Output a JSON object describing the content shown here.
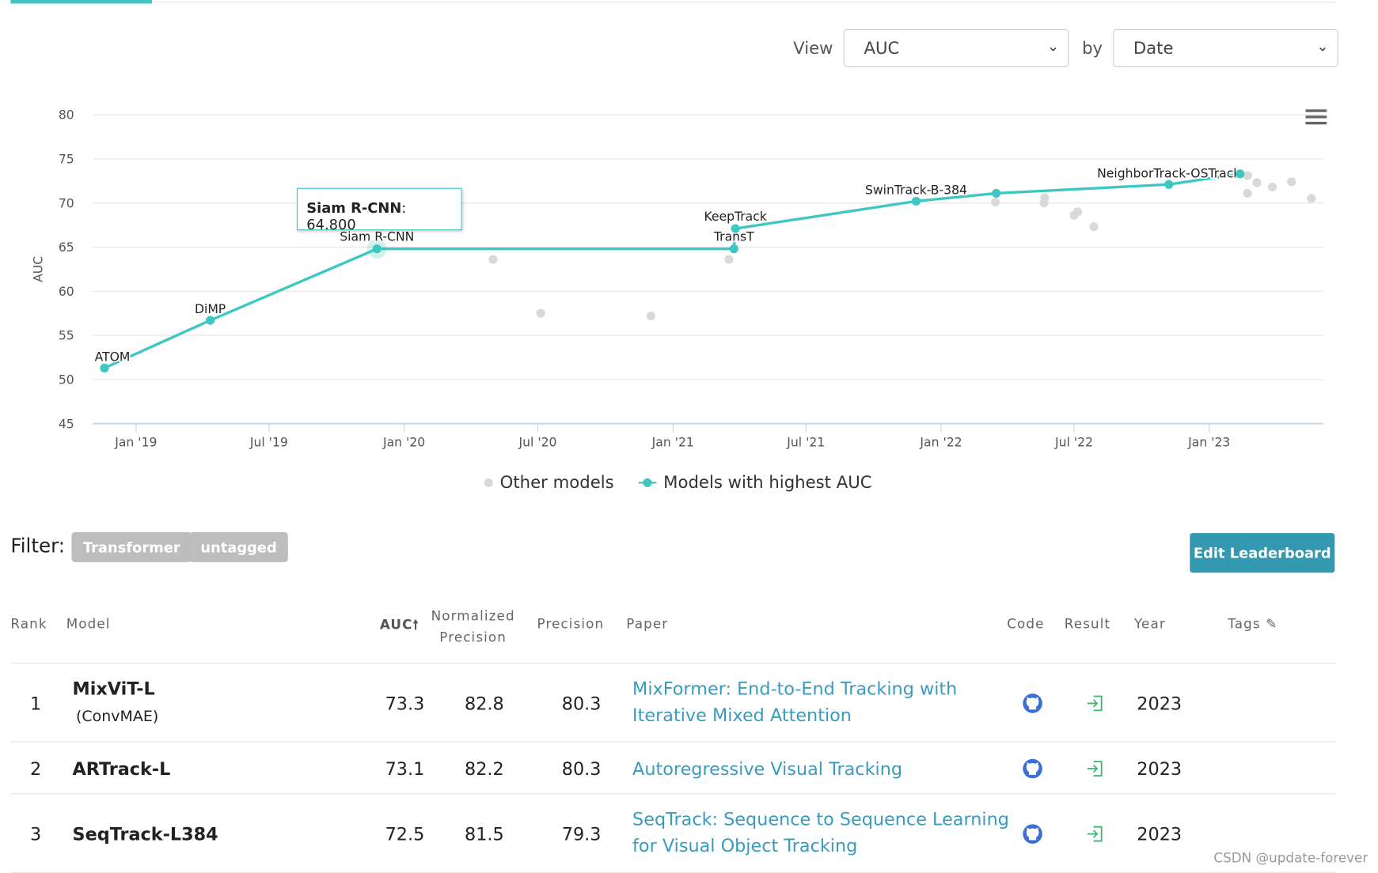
{
  "controls": {
    "view_label": "View",
    "view_value": "AUC",
    "by_label": "by",
    "by_value": "Date"
  },
  "chart_data": {
    "type": "scatter",
    "ylabel": "AUC",
    "ylim": [
      45,
      80
    ],
    "yticks": [
      45,
      50,
      55,
      60,
      65,
      70,
      75,
      80
    ],
    "xticks": [
      {
        "date": "2019-01-01",
        "label": "Jan '19"
      },
      {
        "date": "2019-07-01",
        "label": "Jul '19"
      },
      {
        "date": "2020-01-01",
        "label": "Jan '20"
      },
      {
        "date": "2020-07-01",
        "label": "Jul '20"
      },
      {
        "date": "2021-01-01",
        "label": "Jan '21"
      },
      {
        "date": "2021-07-01",
        "label": "Jul '21"
      },
      {
        "date": "2022-01-01",
        "label": "Jan '22"
      },
      {
        "date": "2022-07-01",
        "label": "Jul '22"
      },
      {
        "date": "2023-01-01",
        "label": "Jan '23"
      }
    ],
    "grid": true,
    "legend_placement": "bottom",
    "colors": {
      "sota": "#3ec7c2",
      "other": "#d9d9d9"
    },
    "series": [
      {
        "name": "Other models",
        "points": [
          {
            "date": "2020-05-01",
            "y": 63.6
          },
          {
            "date": "2020-07-05",
            "y": 57.5
          },
          {
            "date": "2020-12-02",
            "y": 57.2
          },
          {
            "date": "2021-03-18",
            "y": 63.6
          },
          {
            "date": "2022-03-16",
            "y": 70.1
          },
          {
            "date": "2022-05-22",
            "y": 70.6
          },
          {
            "date": "2022-05-21",
            "y": 70.0
          },
          {
            "date": "2022-07-01",
            "y": 68.6
          },
          {
            "date": "2022-07-06",
            "y": 69.0
          },
          {
            "date": "2022-07-28",
            "y": 67.3
          },
          {
            "date": "2023-02-22",
            "y": 73.1
          },
          {
            "date": "2023-03-07",
            "y": 72.3
          },
          {
            "date": "2023-02-22",
            "y": 71.1
          },
          {
            "date": "2023-03-28",
            "y": 71.8
          },
          {
            "date": "2023-04-23",
            "y": 72.4
          },
          {
            "date": "2023-05-20",
            "y": 70.5
          }
        ]
      },
      {
        "name": "Models with highest AUC",
        "points": [
          {
            "date": "2018-11-19",
            "y": 51.3,
            "label": "ATOM"
          },
          {
            "date": "2019-04-12",
            "y": 56.7,
            "label": "DiMP"
          },
          {
            "date": "2019-11-25",
            "y": 64.8,
            "label": "Siam R-CNN"
          },
          {
            "date": "2021-03-25",
            "y": 64.8,
            "label": "TransT"
          },
          {
            "date": "2021-03-27",
            "y": 67.1,
            "label": "KeepTrack"
          },
          {
            "date": "2021-11-28",
            "y": 70.2,
            "label": "SwinTrack-B-384"
          },
          {
            "date": "2022-03-17",
            "y": 71.1
          },
          {
            "date": "2022-11-07",
            "y": 72.1,
            "label": "NeighborTrack-OSTrack"
          },
          {
            "date": "2023-02-12",
            "y": 73.3
          }
        ]
      }
    ],
    "tooltip": {
      "name": "Siam R-CNN",
      "value": "64.800"
    }
  },
  "filter": {
    "label": "Filter:",
    "tags": [
      "Transformer",
      "untagged"
    ],
    "edit_button": "Edit Leaderboard"
  },
  "table": {
    "headers": {
      "rank": "Rank",
      "model": "Model",
      "auc": "AUC",
      "norm1": "Normalized",
      "norm2": "Precision",
      "precision": "Precision",
      "paper": "Paper",
      "code": "Code",
      "result": "Result",
      "year": "Year",
      "tags": "Tags"
    },
    "rows": [
      {
        "rank": "1",
        "model": "MixViT-L",
        "sub": "(ConvMAE)",
        "auc": "73.3",
        "norm": "82.8",
        "prec": "80.3",
        "paper1": "MixFormer: End-to-End Tracking with",
        "paper2": "Iterative Mixed Attention",
        "year": "2023"
      },
      {
        "rank": "2",
        "model": "ARTrack-L",
        "sub": "",
        "auc": "73.1",
        "norm": "82.2",
        "prec": "80.3",
        "paper1": "Autoregressive Visual Tracking",
        "paper2": "",
        "year": "2023"
      },
      {
        "rank": "3",
        "model": "SeqTrack-L384",
        "sub": "",
        "auc": "72.5",
        "norm": "81.5",
        "prec": "79.3",
        "paper1": "SeqTrack: Sequence to Sequence Learning",
        "paper2": "for Visual Object Tracking",
        "year": "2023"
      }
    ]
  },
  "watermark": "CSDN @update-forever"
}
